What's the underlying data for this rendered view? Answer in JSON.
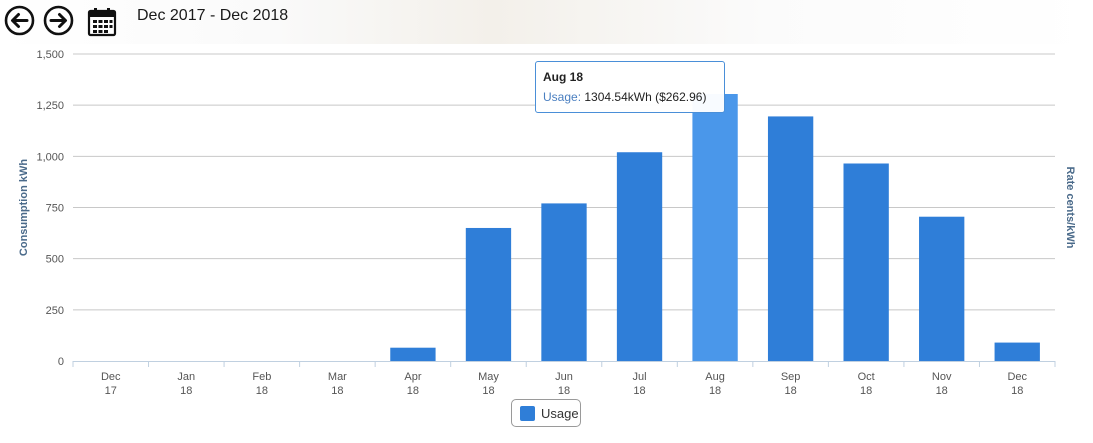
{
  "toolbar": {
    "period_label": "Dec 2017 - Dec 2018",
    "prev_icon": "arrow-left-circle-icon",
    "next_icon": "arrow-right-circle-icon",
    "calendar_icon": "calendar-icon"
  },
  "chart_data": {
    "type": "bar",
    "categories": [
      "Dec\n17",
      "Jan\n18",
      "Feb\n18",
      "Mar\n18",
      "Apr\n18",
      "May\n18",
      "Jun\n18",
      "Jul\n18",
      "Aug\n18",
      "Sep\n18",
      "Oct\n18",
      "Nov\n18",
      "Dec\n18"
    ],
    "series": [
      {
        "name": "Usage",
        "values": [
          0,
          0,
          0,
          0,
          65,
          650,
          770,
          1020,
          1304.54,
          1195,
          965,
          705,
          90
        ]
      }
    ],
    "ylabel": "Consumption kWh",
    "y2label": "Rate cents/kWh",
    "ylim": [
      0,
      1500
    ],
    "yticks": [
      0,
      250,
      500,
      750,
      1000,
      1250,
      1500
    ],
    "ytick_labels": [
      "0",
      "250",
      "500",
      "750",
      "1,000",
      "1,250",
      "1,500"
    ],
    "grid": true,
    "highlighted_index": 8,
    "bar_color": "#2f7ed8",
    "highlight_color": "#4a97ea",
    "legend_position": "bottom-center"
  },
  "tooltip": {
    "title": "Aug 18",
    "label": "Usage:",
    "value": "1304.54kWh ($262.96)"
  },
  "legend": {
    "items": [
      {
        "label": "Usage",
        "color": "#2f7ed8"
      }
    ]
  }
}
